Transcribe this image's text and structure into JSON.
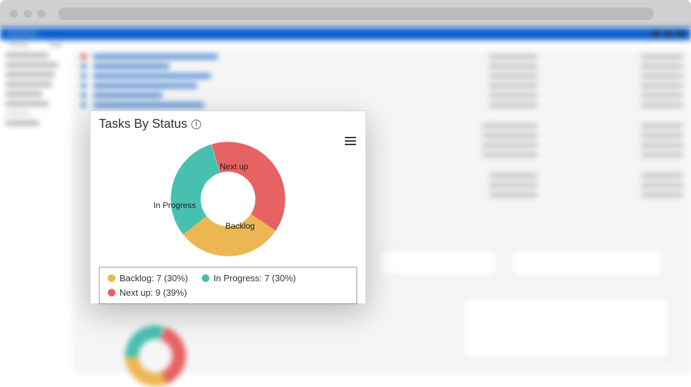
{
  "chart_data": {
    "type": "pie",
    "title": "Tasks By Status",
    "series": [
      {
        "name": "Backlog",
        "value": 7,
        "percent": 30,
        "color": "#ecb753"
      },
      {
        "name": "In Progress",
        "value": 7,
        "percent": 30,
        "color": "#48c0b0"
      },
      {
        "name": "Next up",
        "value": 9,
        "percent": 39,
        "color": "#e76262"
      }
    ]
  },
  "card": {
    "title": "Tasks By Status",
    "legend": {
      "backlog": "Backlog: 7 (30%)",
      "inprogress": "In Progress: 7 (30%)",
      "nextup": "Next up: 9 (39%)"
    },
    "labels": {
      "backlog": "Backlog",
      "inprogress": "In Progress",
      "nextup": "Next up"
    }
  },
  "colors": {
    "backlog": "#ecb753",
    "inprogress": "#48c0b0",
    "nextup": "#e76262"
  }
}
